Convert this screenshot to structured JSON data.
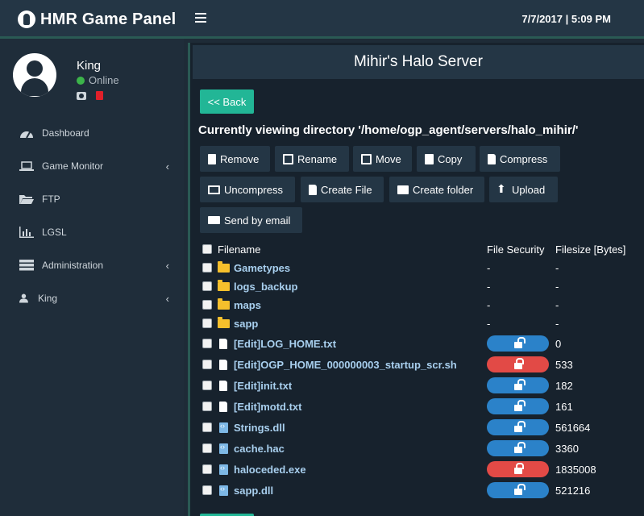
{
  "header": {
    "brand": "HMR Game Panel",
    "datetime": "7/7/2017 | 5:09 PM"
  },
  "user": {
    "name": "King",
    "status": "Online"
  },
  "nav": [
    {
      "label": "Dashboard"
    },
    {
      "label": "Game Monitor",
      "chevron": "‹"
    },
    {
      "label": "FTP"
    },
    {
      "label": "LGSL"
    },
    {
      "label": "Administration",
      "chevron": "‹"
    },
    {
      "label": "King",
      "chevron": "‹"
    }
  ],
  "panel": {
    "title": "Mihir's Halo Server",
    "back_label": "<< Back",
    "directory_text": "Currently viewing directory '/home/ogp_agent/servers/halo_mihir/'"
  },
  "toolbar": {
    "remove": "Remove",
    "rename": "Rename",
    "move": "Move",
    "copy": "Copy",
    "compress": "Compress",
    "uncompress": "Uncompress",
    "create_file": "Create File",
    "create_folder": "Create folder",
    "upload": "Upload",
    "send_email": "Send by email"
  },
  "filelist": {
    "headers": {
      "filename": "Filename",
      "security": "File Security",
      "size": "Filesize [Bytes]"
    },
    "rows": [
      {
        "name": "Gametypes",
        "type": "folder",
        "security": "-",
        "size": "-"
      },
      {
        "name": "logs_backup",
        "type": "folder",
        "security": "-",
        "size": "-"
      },
      {
        "name": "maps",
        "type": "folder",
        "security": "-",
        "size": "-"
      },
      {
        "name": "sapp",
        "type": "folder",
        "security": "-",
        "size": "-"
      },
      {
        "name": "[Edit]LOG_HOME.txt",
        "type": "file",
        "lock": "open",
        "size": "0"
      },
      {
        "name": "[Edit]OGP_HOME_000000003_startup_scr.sh",
        "type": "file",
        "lock": "closed",
        "size": "533"
      },
      {
        "name": "[Edit]init.txt",
        "type": "file",
        "lock": "open",
        "size": "182"
      },
      {
        "name": "[Edit]motd.txt",
        "type": "file",
        "lock": "open",
        "size": "161"
      },
      {
        "name": "Strings.dll",
        "type": "binary",
        "lock": "open",
        "size": "561664"
      },
      {
        "name": "cache.hac",
        "type": "binary",
        "lock": "open",
        "size": "3360"
      },
      {
        "name": "haloceded.exe",
        "type": "binary",
        "lock": "closed",
        "size": "1835008"
      },
      {
        "name": "sapp.dll",
        "type": "binary",
        "lock": "open",
        "size": "521216"
      }
    ]
  },
  "colors": {
    "accent": "#22b696",
    "lock_open": "#2b82c9",
    "lock_closed": "#e24a46",
    "folder": "#f6c02c",
    "link": "#a8cfee"
  }
}
